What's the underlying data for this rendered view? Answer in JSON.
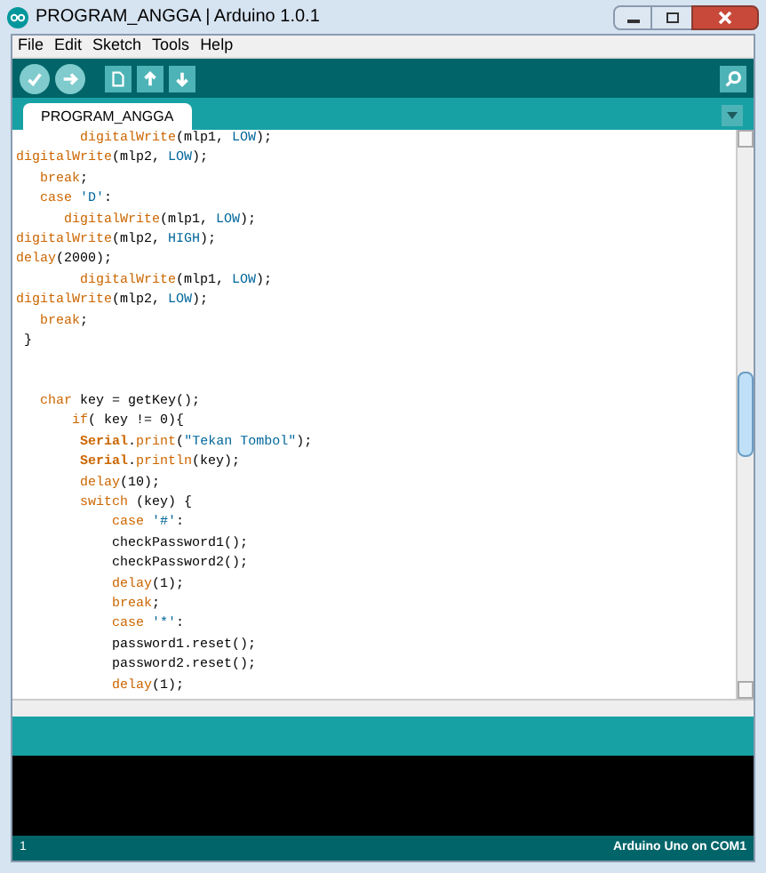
{
  "window": {
    "title": "PROGRAM_ANGGA | Arduino 1.0.1"
  },
  "menu": [
    "File",
    "Edit",
    "Sketch",
    "Tools",
    "Help"
  ],
  "tabs": [
    {
      "label": "PROGRAM_ANGGA",
      "selected": true
    }
  ],
  "code": [
    {
      "kind": "code",
      "tokens": [
        {
          "kind": "fn",
          "t": "        digitalWrite"
        },
        {
          "kind": "plain",
          "t": "(mlp1, "
        },
        {
          "kind": "const",
          "t": "LOW"
        },
        {
          "kind": "plain",
          "t": ");"
        }
      ]
    },
    {
      "kind": "code",
      "tokens": [
        {
          "kind": "fn",
          "t": "digitalWrite"
        },
        {
          "kind": "plain",
          "t": "(mlp2, "
        },
        {
          "kind": "const",
          "t": "LOW"
        },
        {
          "kind": "plain",
          "t": ");"
        }
      ]
    },
    {
      "kind": "code",
      "tokens": [
        {
          "kind": "fn",
          "t": "   break"
        },
        {
          "kind": "plain",
          "t": ";"
        }
      ]
    },
    {
      "kind": "code",
      "tokens": [
        {
          "kind": "fn",
          "t": "   case"
        },
        {
          "kind": "const",
          "t": " 'D'"
        },
        {
          "kind": "plain",
          "t": ":"
        }
      ]
    },
    {
      "kind": "code",
      "tokens": [
        {
          "kind": "fn",
          "t": "      digitalWrite"
        },
        {
          "kind": "plain",
          "t": "(mlp1, "
        },
        {
          "kind": "const",
          "t": "LOW"
        },
        {
          "kind": "plain",
          "t": ");"
        }
      ]
    },
    {
      "kind": "code",
      "tokens": [
        {
          "kind": "fn",
          "t": "digitalWrite"
        },
        {
          "kind": "plain",
          "t": "(mlp2, "
        },
        {
          "kind": "const",
          "t": "HIGH"
        },
        {
          "kind": "plain",
          "t": ");"
        }
      ]
    },
    {
      "kind": "code",
      "tokens": [
        {
          "kind": "fn",
          "t": "delay"
        },
        {
          "kind": "plain",
          "t": "(2000);"
        }
      ]
    },
    {
      "kind": "code",
      "tokens": [
        {
          "kind": "fn",
          "t": "        digitalWrite"
        },
        {
          "kind": "plain",
          "t": "(mlp1, "
        },
        {
          "kind": "const",
          "t": "LOW"
        },
        {
          "kind": "plain",
          "t": ");"
        }
      ]
    },
    {
      "kind": "code",
      "tokens": [
        {
          "kind": "fn",
          "t": "digitalWrite"
        },
        {
          "kind": "plain",
          "t": "(mlp2, "
        },
        {
          "kind": "const",
          "t": "LOW"
        },
        {
          "kind": "plain",
          "t": ");"
        }
      ]
    },
    {
      "kind": "code",
      "tokens": [
        {
          "kind": "fn",
          "t": "   break"
        },
        {
          "kind": "plain",
          "t": ";"
        }
      ]
    },
    {
      "kind": "code",
      "tokens": [
        {
          "kind": "plain",
          "t": " }"
        }
      ]
    },
    {
      "kind": "blank"
    },
    {
      "kind": "blank"
    },
    {
      "kind": "code",
      "tokens": [
        {
          "kind": "fn",
          "t": "   char"
        },
        {
          "kind": "plain",
          "t": " key = getKey();"
        }
      ]
    },
    {
      "kind": "code",
      "tokens": [
        {
          "kind": "fn",
          "t": "       if"
        },
        {
          "kind": "plain",
          "t": "( key != 0){"
        }
      ]
    },
    {
      "kind": "code",
      "tokens": [
        {
          "kind": "class",
          "t": "        Serial"
        },
        {
          "kind": "plain",
          "t": "."
        },
        {
          "kind": "fn",
          "t": "print"
        },
        {
          "kind": "plain",
          "t": "("
        },
        {
          "kind": "const",
          "t": "\"Tekan Tombol\""
        },
        {
          "kind": "plain",
          "t": ");"
        }
      ]
    },
    {
      "kind": "code",
      "tokens": [
        {
          "kind": "class",
          "t": "        Serial"
        },
        {
          "kind": "plain",
          "t": "."
        },
        {
          "kind": "fn",
          "t": "println"
        },
        {
          "kind": "plain",
          "t": "(key);"
        }
      ]
    },
    {
      "kind": "code",
      "tokens": [
        {
          "kind": "fn",
          "t": "        delay"
        },
        {
          "kind": "plain",
          "t": "(10);"
        }
      ]
    },
    {
      "kind": "code",
      "tokens": [
        {
          "kind": "fn",
          "t": "        switch"
        },
        {
          "kind": "plain",
          "t": " (key) {"
        }
      ]
    },
    {
      "kind": "code",
      "tokens": [
        {
          "kind": "fn",
          "t": "            case"
        },
        {
          "kind": "const",
          "t": " '#'"
        },
        {
          "kind": "plain",
          "t": ":"
        }
      ]
    },
    {
      "kind": "code",
      "tokens": [
        {
          "kind": "plain",
          "t": "            checkPassword1();"
        }
      ]
    },
    {
      "kind": "code",
      "tokens": [
        {
          "kind": "plain",
          "t": "            checkPassword2();"
        }
      ]
    },
    {
      "kind": "code",
      "tokens": [
        {
          "kind": "fn",
          "t": "            delay"
        },
        {
          "kind": "plain",
          "t": "(1);"
        }
      ]
    },
    {
      "kind": "code",
      "tokens": [
        {
          "kind": "fn",
          "t": "            break"
        },
        {
          "kind": "plain",
          "t": ";"
        }
      ]
    },
    {
      "kind": "code",
      "tokens": [
        {
          "kind": "fn",
          "t": "            case"
        },
        {
          "kind": "const",
          "t": " '*'"
        },
        {
          "kind": "plain",
          "t": ":"
        }
      ]
    },
    {
      "kind": "code",
      "tokens": [
        {
          "kind": "plain",
          "t": "            password1.reset();"
        }
      ]
    },
    {
      "kind": "code",
      "tokens": [
        {
          "kind": "plain",
          "t": "            password2.reset();"
        }
      ]
    },
    {
      "kind": "code",
      "tokens": [
        {
          "kind": "fn",
          "t": "            delay"
        },
        {
          "kind": "plain",
          "t": "(1);"
        }
      ]
    }
  ],
  "status": {
    "line": "1",
    "board": "Arduino Uno on COM1"
  }
}
